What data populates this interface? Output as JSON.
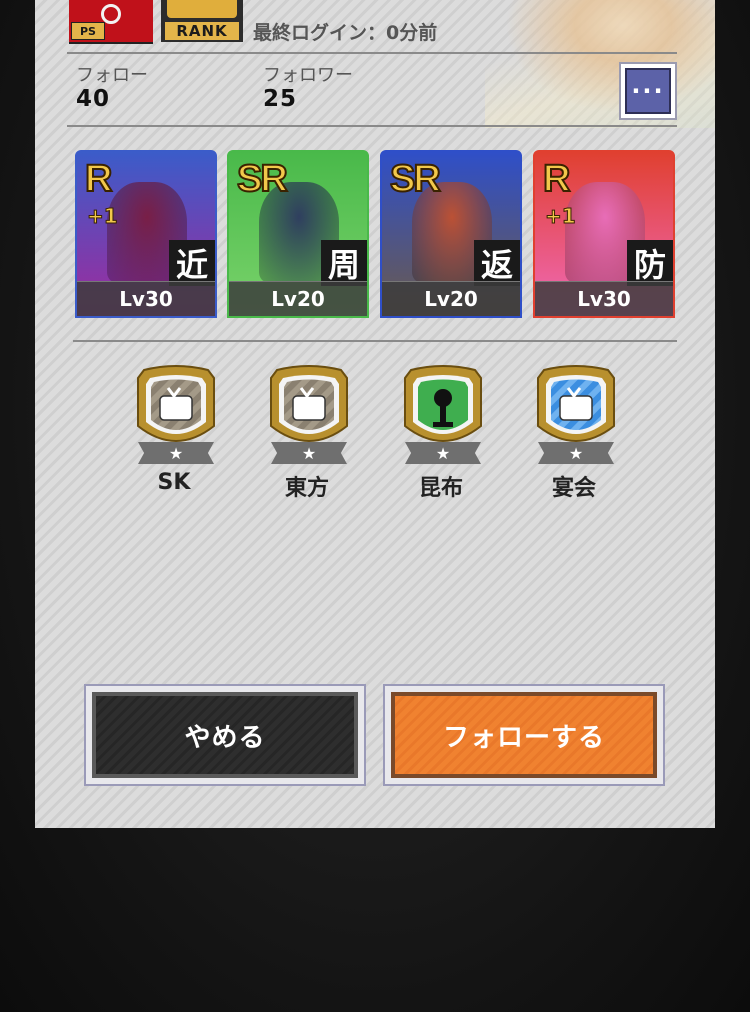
{
  "header": {
    "rank_label": "RANK",
    "ps_label": "PS",
    "last_login": "最終ログイン：0分前"
  },
  "stats": {
    "follow_label": "フォロー",
    "follow_value": "40",
    "follower_label": "フォロワー",
    "follower_value": "25"
  },
  "menu_button": {
    "glyph": "···"
  },
  "cards": [
    {
      "rarity": "R",
      "plus": "+1",
      "role": "近",
      "level": "Lv30",
      "color_top": "#3b5cc9",
      "color_bottom": "#a02a9c",
      "figure_color": "#7b1a3a"
    },
    {
      "rarity": "SR",
      "plus": "",
      "role": "周",
      "level": "Lv20",
      "color_top": "#49b94a",
      "color_bottom": "#7ad36b",
      "figure_color": "#2a3060"
    },
    {
      "rarity": "SR",
      "plus": "",
      "role": "返",
      "level": "Lv20",
      "color_top": "#2f4fc8",
      "color_bottom": "#6b5a4c",
      "figure_color": "#c8512a"
    },
    {
      "rarity": "R",
      "plus": "+1",
      "role": "防",
      "level": "Lv30",
      "color_top": "#e04030",
      "color_bottom": "#f06ab8",
      "figure_color": "#e870c0"
    }
  ],
  "badges": [
    {
      "label": "SK",
      "icon": "tv-icon",
      "fill": "#8a8070",
      "stripe": "#a49a88",
      "star": "★"
    },
    {
      "label": "東方",
      "icon": "tv-icon",
      "fill": "#8a8070",
      "stripe": "#a49a88",
      "star": "★"
    },
    {
      "label": "昆布",
      "icon": "microphone-icon",
      "fill": "#3fae4f",
      "stripe": "#3fae4f",
      "star": "★"
    },
    {
      "label": "宴会",
      "icon": "tv-icon",
      "fill": "#3b8ee0",
      "stripe": "#6fb2f0",
      "star": "★"
    }
  ],
  "buttons": {
    "cancel_label": "やめる",
    "follow_label": "フォローする"
  },
  "colors": {
    "accent_orange": "#f08230",
    "badge_gold": "#b8902e",
    "menu_blue": "#5c62a8"
  }
}
